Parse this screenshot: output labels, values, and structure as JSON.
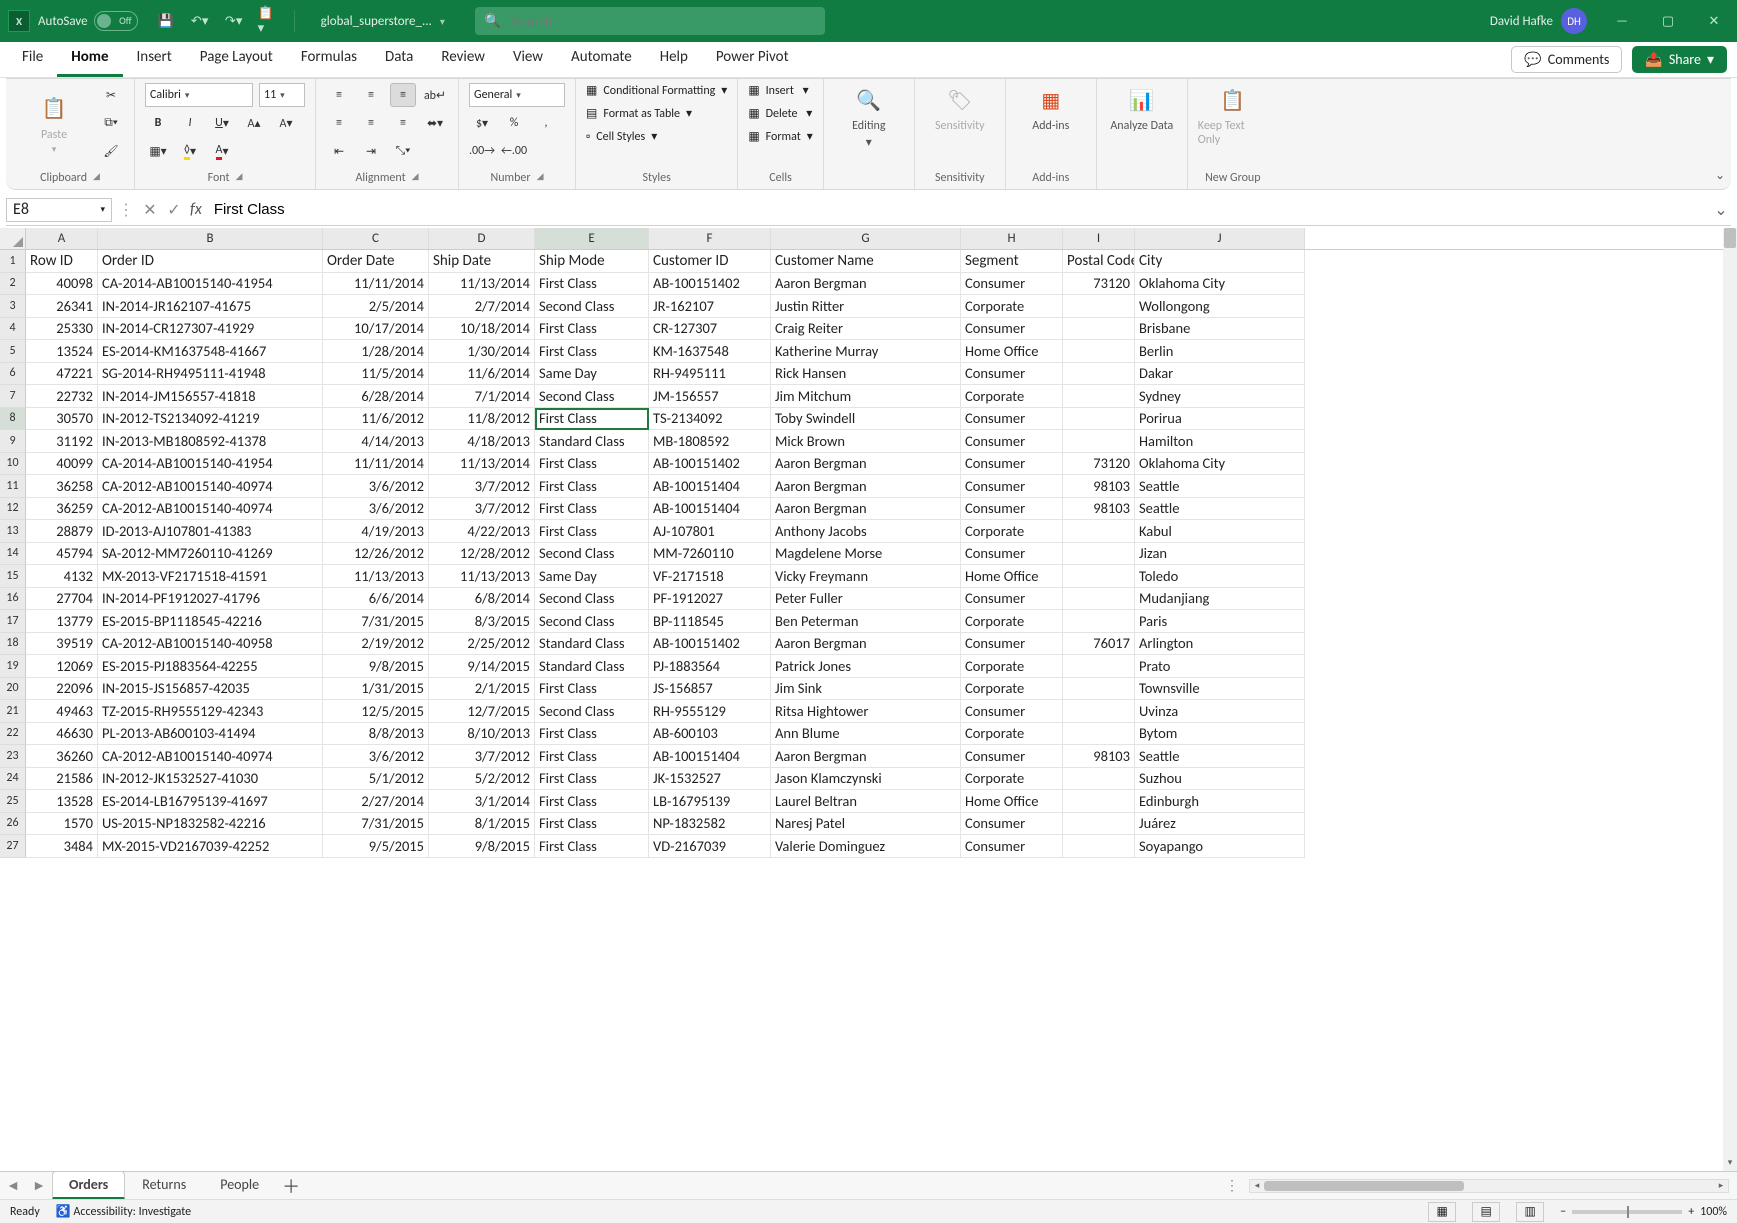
{
  "title": {
    "autosave_label": "AutoSave",
    "autosave_state": "Off",
    "filename": "global_superstore_...",
    "search_placeholder": "Search",
    "user_name": "David Hafke",
    "user_initials": "DH"
  },
  "tabs": [
    "File",
    "Home",
    "Insert",
    "Page Layout",
    "Formulas",
    "Data",
    "Review",
    "View",
    "Automate",
    "Help",
    "Power Pivot"
  ],
  "active_tab": "Home",
  "ribbon_right": {
    "comments": "Comments",
    "share": "Share"
  },
  "ribbon": {
    "clipboard": {
      "paste": "Paste",
      "label": "Clipboard"
    },
    "font": {
      "name": "Calibri",
      "size": "11",
      "label": "Font"
    },
    "alignment": {
      "label": "Alignment"
    },
    "number": {
      "format": "General",
      "label": "Number"
    },
    "styles": {
      "cond": "Conditional Formatting",
      "table": "Format as Table",
      "cell": "Cell Styles",
      "label": "Styles"
    },
    "cells": {
      "insert": "Insert",
      "delete": "Delete",
      "format": "Format",
      "label": "Cells"
    },
    "editing": {
      "label": "Editing"
    },
    "sensitivity": {
      "btn": "Sensitivity",
      "label": "Sensitivity"
    },
    "addins": {
      "btn": "Add-ins",
      "label": "Add-ins"
    },
    "analyze": {
      "btn": "Analyze Data"
    },
    "keep": {
      "btn": "Keep Text Only",
      "label": "New Group"
    }
  },
  "namebox": "E8",
  "formula": "First Class",
  "col_headers": [
    "A",
    "B",
    "C",
    "D",
    "E",
    "F",
    "G",
    "H",
    "I",
    "J"
  ],
  "header_row": [
    "Row ID",
    "Order ID",
    "Order Date",
    "Ship Date",
    "Ship Mode",
    "Customer ID",
    "Customer Name",
    "Segment",
    "Postal Code",
    "City"
  ],
  "selected": {
    "row": 8,
    "col": 4
  },
  "rows": [
    [
      "40098",
      "CA-2014-AB10015140-41954",
      "11/11/2014",
      "11/13/2014",
      "First Class",
      "AB-100151402",
      "Aaron Bergman",
      "Consumer",
      "73120",
      "Oklahoma City"
    ],
    [
      "26341",
      "IN-2014-JR162107-41675",
      "2/5/2014",
      "2/7/2014",
      "Second Class",
      "JR-162107",
      "Justin Ritter",
      "Corporate",
      "",
      "Wollongong"
    ],
    [
      "25330",
      "IN-2014-CR127307-41929",
      "10/17/2014",
      "10/18/2014",
      "First Class",
      "CR-127307",
      "Craig Reiter",
      "Consumer",
      "",
      "Brisbane"
    ],
    [
      "13524",
      "ES-2014-KM1637548-41667",
      "1/28/2014",
      "1/30/2014",
      "First Class",
      "KM-1637548",
      "Katherine Murray",
      "Home Office",
      "",
      "Berlin"
    ],
    [
      "47221",
      "SG-2014-RH9495111-41948",
      "11/5/2014",
      "11/6/2014",
      "Same Day",
      "RH-9495111",
      "Rick Hansen",
      "Consumer",
      "",
      "Dakar"
    ],
    [
      "22732",
      "IN-2014-JM156557-41818",
      "6/28/2014",
      "7/1/2014",
      "Second Class",
      "JM-156557",
      "Jim Mitchum",
      "Corporate",
      "",
      "Sydney"
    ],
    [
      "30570",
      "IN-2012-TS2134092-41219",
      "11/6/2012",
      "11/8/2012",
      "First Class",
      "TS-2134092",
      "Toby Swindell",
      "Consumer",
      "",
      "Porirua"
    ],
    [
      "31192",
      "IN-2013-MB1808592-41378",
      "4/14/2013",
      "4/18/2013",
      "Standard Class",
      "MB-1808592",
      "Mick Brown",
      "Consumer",
      "",
      "Hamilton"
    ],
    [
      "40099",
      "CA-2014-AB10015140-41954",
      "11/11/2014",
      "11/13/2014",
      "First Class",
      "AB-100151402",
      "Aaron Bergman",
      "Consumer",
      "73120",
      "Oklahoma City"
    ],
    [
      "36258",
      "CA-2012-AB10015140-40974",
      "3/6/2012",
      "3/7/2012",
      "First Class",
      "AB-100151404",
      "Aaron Bergman",
      "Consumer",
      "98103",
      "Seattle"
    ],
    [
      "36259",
      "CA-2012-AB10015140-40974",
      "3/6/2012",
      "3/7/2012",
      "First Class",
      "AB-100151404",
      "Aaron Bergman",
      "Consumer",
      "98103",
      "Seattle"
    ],
    [
      "28879",
      "ID-2013-AJ107801-41383",
      "4/19/2013",
      "4/22/2013",
      "First Class",
      "AJ-107801",
      "Anthony Jacobs",
      "Corporate",
      "",
      "Kabul"
    ],
    [
      "45794",
      "SA-2012-MM7260110-41269",
      "12/26/2012",
      "12/28/2012",
      "Second Class",
      "MM-7260110",
      "Magdelene Morse",
      "Consumer",
      "",
      "Jizan"
    ],
    [
      "4132",
      "MX-2013-VF2171518-41591",
      "11/13/2013",
      "11/13/2013",
      "Same Day",
      "VF-2171518",
      "Vicky Freymann",
      "Home Office",
      "",
      "Toledo"
    ],
    [
      "27704",
      "IN-2014-PF1912027-41796",
      "6/6/2014",
      "6/8/2014",
      "Second Class",
      "PF-1912027",
      "Peter Fuller",
      "Consumer",
      "",
      "Mudanjiang"
    ],
    [
      "13779",
      "ES-2015-BP1118545-42216",
      "7/31/2015",
      "8/3/2015",
      "Second Class",
      "BP-1118545",
      "Ben Peterman",
      "Corporate",
      "",
      "Paris"
    ],
    [
      "39519",
      "CA-2012-AB10015140-40958",
      "2/19/2012",
      "2/25/2012",
      "Standard Class",
      "AB-100151402",
      "Aaron Bergman",
      "Consumer",
      "76017",
      "Arlington"
    ],
    [
      "12069",
      "ES-2015-PJ1883564-42255",
      "9/8/2015",
      "9/14/2015",
      "Standard Class",
      "PJ-1883564",
      "Patrick Jones",
      "Corporate",
      "",
      "Prato"
    ],
    [
      "22096",
      "IN-2015-JS156857-42035",
      "1/31/2015",
      "2/1/2015",
      "First Class",
      "JS-156857",
      "Jim Sink",
      "Corporate",
      "",
      "Townsville"
    ],
    [
      "49463",
      "TZ-2015-RH9555129-42343",
      "12/5/2015",
      "12/7/2015",
      "Second Class",
      "RH-9555129",
      "Ritsa Hightower",
      "Consumer",
      "",
      "Uvinza"
    ],
    [
      "46630",
      "PL-2013-AB600103-41494",
      "8/8/2013",
      "8/10/2013",
      "First Class",
      "AB-600103",
      "Ann Blume",
      "Corporate",
      "",
      "Bytom"
    ],
    [
      "36260",
      "CA-2012-AB10015140-40974",
      "3/6/2012",
      "3/7/2012",
      "First Class",
      "AB-100151404",
      "Aaron Bergman",
      "Consumer",
      "98103",
      "Seattle"
    ],
    [
      "21586",
      "IN-2012-JK1532527-41030",
      "5/1/2012",
      "5/2/2012",
      "First Class",
      "JK-1532527",
      "Jason Klamczynski",
      "Corporate",
      "",
      "Suzhou"
    ],
    [
      "13528",
      "ES-2014-LB16795139-41697",
      "2/27/2014",
      "3/1/2014",
      "First Class",
      "LB-16795139",
      "Laurel Beltran",
      "Home Office",
      "",
      "Edinburgh"
    ],
    [
      "1570",
      "US-2015-NP1832582-42216",
      "7/31/2015",
      "8/1/2015",
      "First Class",
      "NP-1832582",
      "Naresj Patel",
      "Consumer",
      "",
      "Juárez"
    ],
    [
      "3484",
      "MX-2015-VD2167039-42252",
      "9/5/2015",
      "9/8/2015",
      "First Class",
      "VD-2167039",
      "Valerie Dominguez",
      "Consumer",
      "",
      "Soyapango"
    ]
  ],
  "right_align": [
    true,
    false,
    true,
    true,
    false,
    false,
    false,
    false,
    true,
    false
  ],
  "sheets": [
    "Orders",
    "Returns",
    "People"
  ],
  "active_sheet": "Orders",
  "status": {
    "ready": "Ready",
    "access": "Accessibility: Investigate",
    "zoom": "100%"
  }
}
